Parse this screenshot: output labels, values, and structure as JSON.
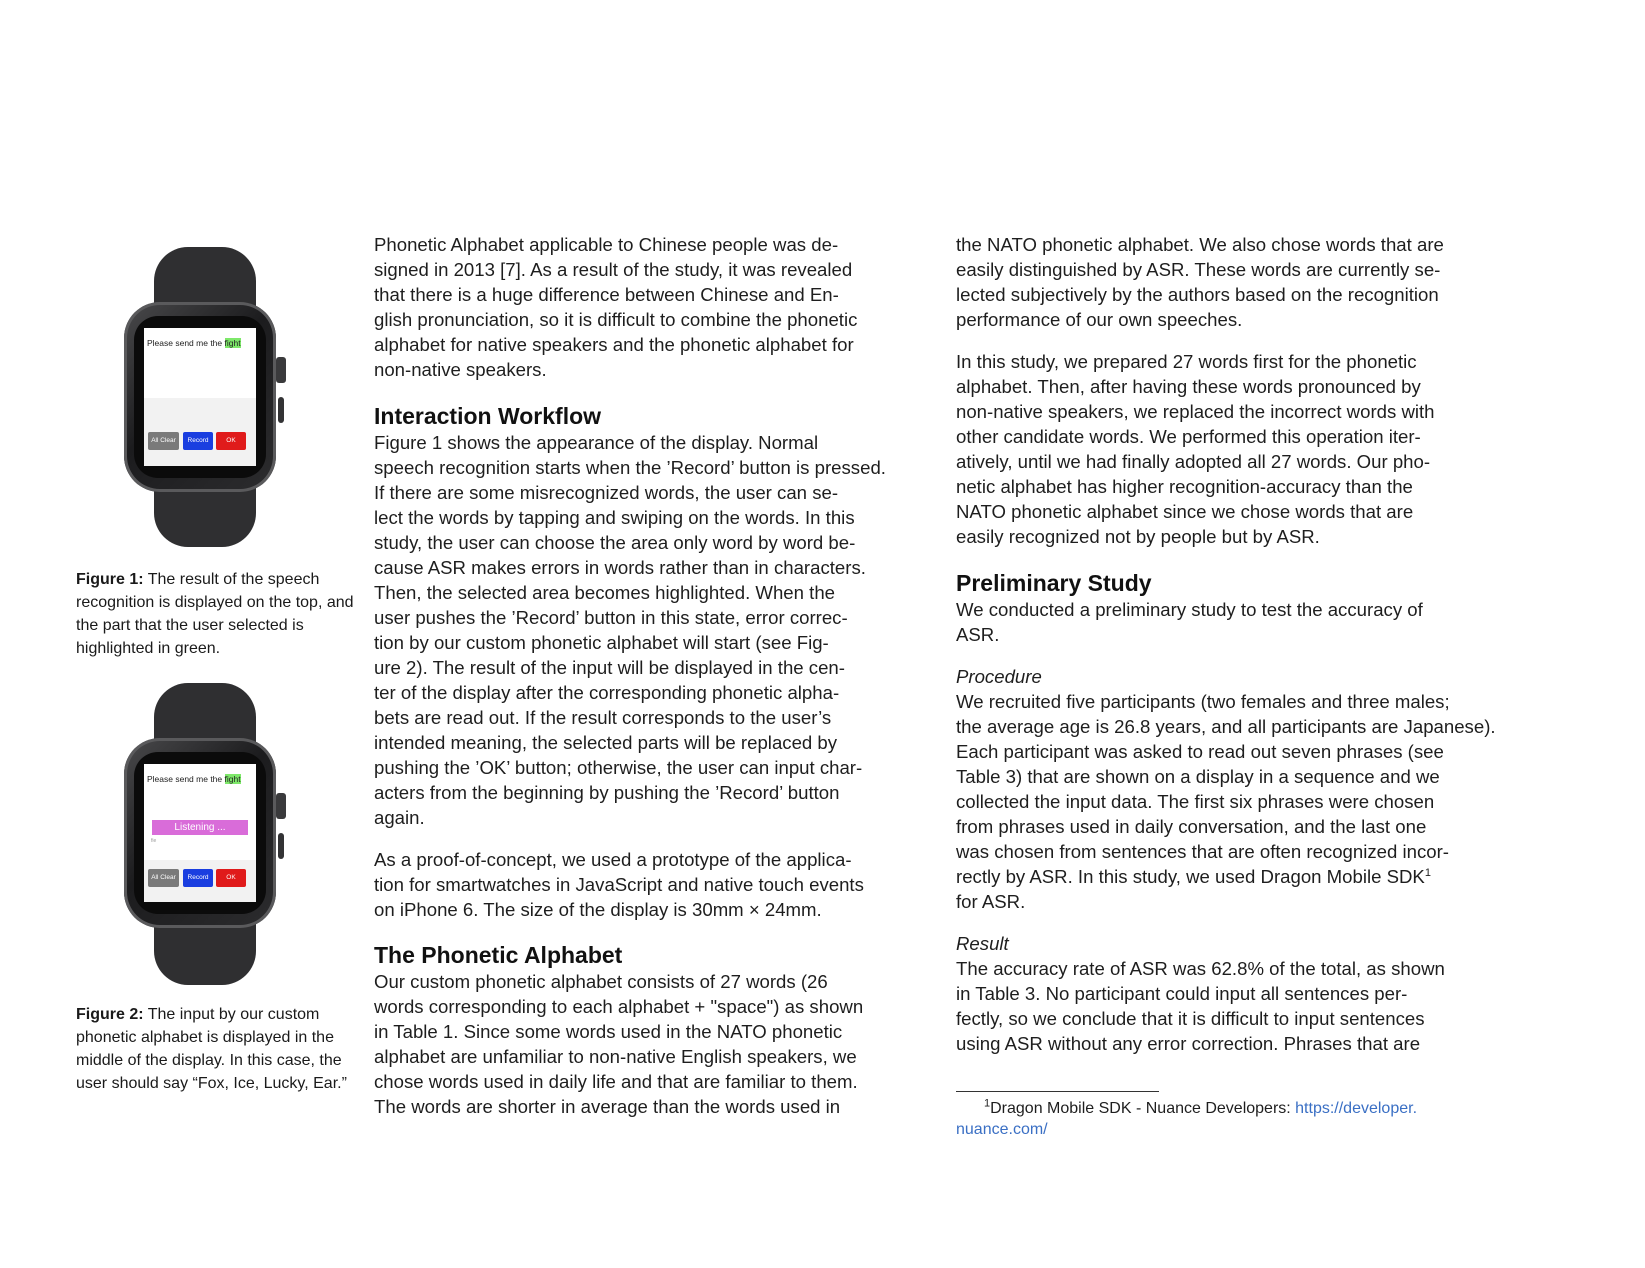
{
  "figure1": {
    "screen_text": "Please send me the",
    "screen_highlight": "fight",
    "small_text": "fight",
    "buttons": {
      "all_clear": "All Clear",
      "record": "Record",
      "ok": "OK"
    },
    "caption_label": "Figure 1:",
    "caption_text": "The result of the speech recognition is displayed on the top, and the part that the user selected is highlighted in green."
  },
  "figure2": {
    "screen_text": "Please send me the",
    "screen_highlight": "fight",
    "listening": "Listening ...",
    "small_text": "fie",
    "buttons": {
      "all_clear": "All Clear",
      "record": "Record",
      "ok": "OK"
    },
    "caption_label": "Figure 2:",
    "caption_text": "The input by our custom phonetic alphabet is displayed in the middle of the display. In this case, the user should say “Fox, Ice, Lucky, Ear.”"
  },
  "col2": {
    "para1": [
      "Phonetic Alphabet applicable to Chinese people was de-",
      "signed in 2013 [7]. As a result of the study, it was revealed",
      "that there is a huge difference between Chinese and En-",
      "glish pronunciation, so it is difficult to combine the phonetic",
      "alphabet for native speakers and the phonetic alphabet for",
      "non-native speakers."
    ],
    "heading1": "Interaction Workflow",
    "para2": [
      "Figure 1 shows the appearance of the display. Normal",
      "speech recognition starts when the ’Record’ button is pressed.",
      "If there are some misrecognized words, the user can se-",
      "lect the words by tapping and swiping on the words. In this",
      "study, the user can choose the area only word by word be-",
      "cause ASR makes errors in words rather than in characters.",
      "Then, the selected area becomes highlighted. When the",
      "user pushes the ’Record’ button in this state, error correc-",
      "tion by our custom phonetic alphabet will start (see Fig-",
      "ure 2). The result of the input will be displayed in the cen-",
      "ter of the display after the corresponding phonetic alpha-",
      "bets are read out. If the result corresponds to the user’s",
      "intended meaning, the selected parts will be replaced by",
      "pushing the ’OK’ button; otherwise, the user can input char-",
      "acters from the beginning by pushing the ’Record’ button",
      "again."
    ],
    "para3": [
      "As a proof-of-concept, we used a prototype of the applica-",
      "tion for smartwatches in JavaScript and native touch events",
      "on iPhone 6. The size of the display is 30mm × 24mm."
    ],
    "heading2": "The Phonetic Alphabet",
    "para4": [
      "Our custom phonetic alphabet consists of 27 words (26",
      "words corresponding to each alphabet + \"space\") as shown",
      "in Table 1. Since some words used in the NATO phonetic",
      "alphabet are unfamiliar to non-native English speakers, we",
      "chose words used in daily life and that are familiar to them.",
      "The words are shorter in average than the words used in"
    ]
  },
  "col3": {
    "para1": [
      "the NATO phonetic alphabet. We also chose words that are",
      "easily distinguished by ASR. These words are currently se-",
      "lected subjectively by the authors based on the recognition",
      "performance of our own speeches."
    ],
    "para2": [
      "In this study, we prepared 27 words first for the phonetic",
      "alphabet. Then, after having these words pronounced by",
      "non-native speakers, we replaced the incorrect words with",
      "other candidate words. We performed this operation iter-",
      "atively, until we had finally adopted all 27 words. Our pho-",
      "netic alphabet has higher recognition-accuracy than the",
      "NATO phonetic alphabet since we chose words that are",
      "easily recognized not by people but by ASR."
    ],
    "heading1": "Preliminary Study",
    "para3": [
      "We conducted a preliminary study to test the accuracy of",
      "ASR."
    ],
    "subheading1": "Procedure",
    "para4": [
      "We recruited five participants (two females and three males;",
      "the average age is 26.8 years, and all participants are Japanese).",
      "Each participant was asked to read out seven phrases (see",
      "Table 3) that are shown on a display in a sequence and we",
      "collected the input data. The first six phrases were chosen",
      "from phrases used in daily conversation, and the last one",
      "was chosen from sentences that are often recognized incor-",
      "rectly by ASR. In this study, we used Dragon Mobile SDK"
    ],
    "footnote_mark": "1",
    "para4_end": "for ASR.",
    "subheading2": "Result",
    "para5": [
      "The accuracy rate of ASR was 62.8% of the total, as shown",
      "in Table 3. No participant could input all sentences per-",
      "fectly, so we conclude that it is difficult to input sentences",
      "using ASR without any error correction. Phrases that are"
    ],
    "footnote": {
      "number": "1",
      "text": "Dragon Mobile SDK - Nuance Developers: ",
      "link_line1": "https://developer.",
      "link_line2": "nuance.com/"
    }
  }
}
